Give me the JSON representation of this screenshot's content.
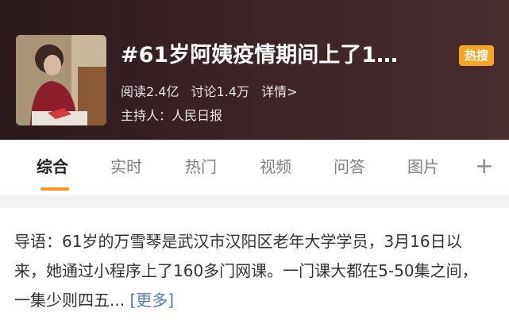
{
  "topic": {
    "title": "#61岁阿姨疫情期间上了1…",
    "badge": "热搜",
    "reads": "阅读2.4亿",
    "discussions": "讨论1.4万",
    "details": "详情>",
    "host": "主持人：人民日报",
    "thumbnail_icon": "photo-woman-at-desk"
  },
  "tabs": [
    {
      "label": "综合",
      "active": true
    },
    {
      "label": "实时",
      "active": false
    },
    {
      "label": "热门",
      "active": false
    },
    {
      "label": "视频",
      "active": false
    },
    {
      "label": "问答",
      "active": false
    },
    {
      "label": "图片",
      "active": false
    }
  ],
  "tabs_more": "+",
  "lead": {
    "text": "导语：61岁的万雪琴是武汉市汉阳区老年大学学员，3月16日以来，她通过小程序上了160多门网课。一门课大都在5-50集之间，一集少则四五... ",
    "more": "[更多]"
  },
  "colors": {
    "accent": "#f7931e",
    "badge": "#f5a623",
    "link": "#5a7ab5"
  }
}
